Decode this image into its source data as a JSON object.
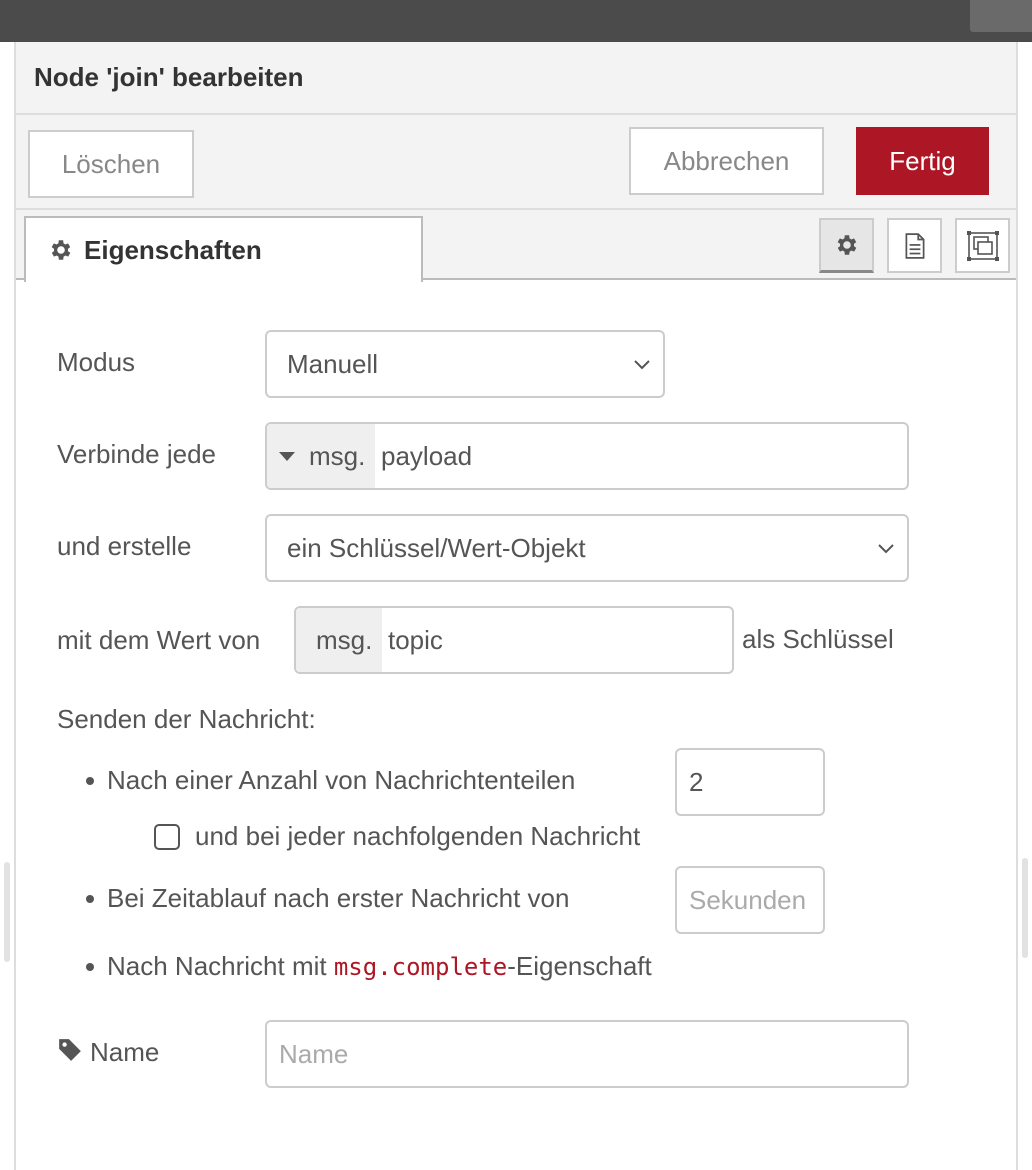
{
  "tray": {
    "title": "Node 'join' bearbeiten",
    "buttons": {
      "delete": "Löschen",
      "cancel": "Abbrechen",
      "done": "Fertig"
    },
    "tabs": [
      {
        "label": "Eigenschaften",
        "icon": "gear-icon"
      }
    ],
    "side_buttons": [
      {
        "icon": "gear-icon",
        "selected": true
      },
      {
        "icon": "document-icon",
        "selected": false
      },
      {
        "icon": "appearance-icon",
        "selected": false
      }
    ]
  },
  "form": {
    "mode": {
      "label": "Modus",
      "value": "Manuell"
    },
    "combine": {
      "label": "Verbinde jede",
      "prefix": "msg.",
      "value": "payload"
    },
    "create": {
      "label": "und erstelle",
      "value": "ein Schlüssel/Wert-Objekt"
    },
    "key": {
      "label": "mit dem Wert von",
      "prefix": "msg.",
      "value": "topic",
      "suffix": "als Schlüssel"
    },
    "send": {
      "heading": "Senden der Nachricht:",
      "count": {
        "label": "Nach einer Anzahl von Nachrichtenteilen",
        "value": "2"
      },
      "each_subsequent": {
        "label": "und bei jeder nachfolgenden Nachricht",
        "checked": false
      },
      "timeout": {
        "label": "Bei Zeitablauf nach erster Nachricht von",
        "placeholder": "Sekunden"
      },
      "complete": {
        "before": "Nach Nachricht mit ",
        "code": "msg.complete",
        "after": "-Eigenschaft"
      }
    },
    "name": {
      "label": "Name",
      "placeholder": "Name",
      "icon": "tag-icon"
    }
  },
  "colors": {
    "accent": "#ad1625",
    "header_bg": "#f3f3f3",
    "border": "#cccccc"
  }
}
